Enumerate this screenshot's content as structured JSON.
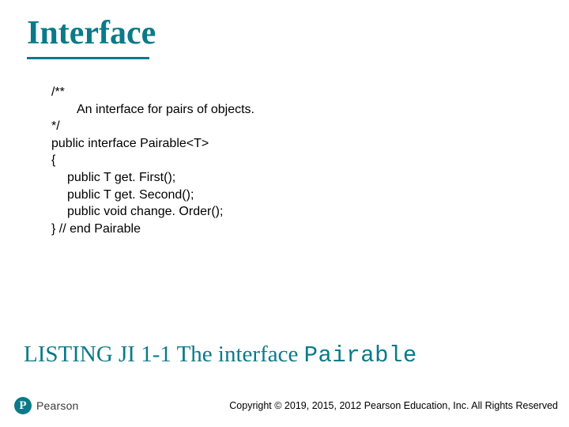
{
  "title": "Interface",
  "code": {
    "l1": "/**",
    "l2": "An interface for pairs of objects.",
    "l3": "*/",
    "l4": "public interface Pairable<T>",
    "l5": "{",
    "l6": "public T get. First();",
    "l7": "public T get. Second();",
    "l8": "public void change. Order();",
    "l9": "} // end Pairable"
  },
  "listing": {
    "prefix": "LISTING JI 1-1 The interface ",
    "classname": "Pairable"
  },
  "footer": {
    "logo_letter": "P",
    "brand": "Pearson",
    "copyright": "Copyright © 2019, 2015, 2012 Pearson Education, Inc. All Rights Reserved"
  }
}
